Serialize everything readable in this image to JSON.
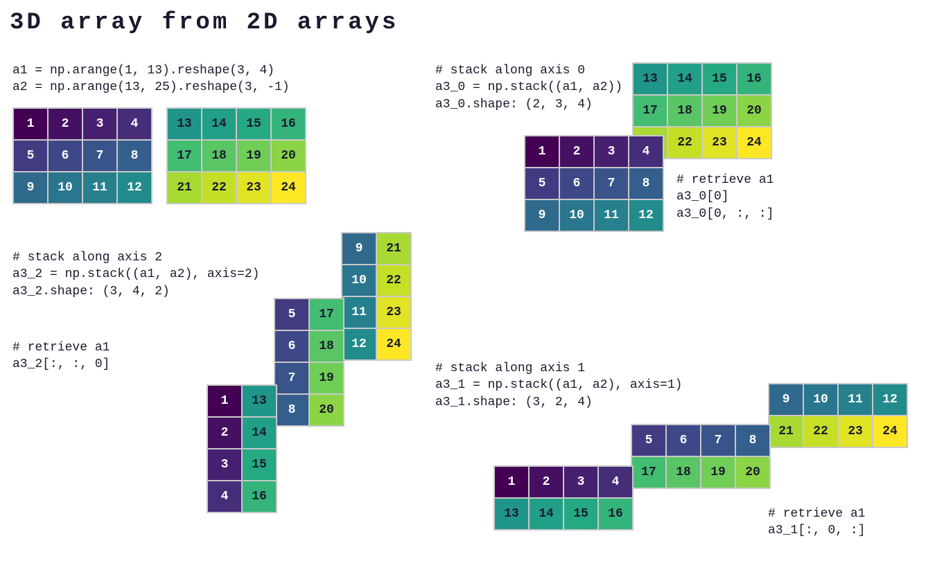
{
  "title": "3D array from 2D arrays",
  "colors": {
    "1": "#440154",
    "2": "#481a6c",
    "3": "#472f7d",
    "4": "#414487",
    "5": "#39568c",
    "6": "#31688e",
    "7": "#2a788e",
    "8": "#23888e",
    "9": "#1f988b",
    "10": "#22a884",
    "11": "#35b779",
    "12": "#54c568",
    "13": "#22a884",
    "14": "#35b779",
    "15": "#54c568",
    "16": "#7ad151",
    "17": "#7ad151",
    "18": "#a5db36",
    "19": "#a5db36",
    "20": "#d2e21b",
    "21": "#a5db36",
    "22": "#d2e21b",
    "23": "#d2e21b",
    "24": "#fde725"
  },
  "viridis24": {
    "1": "#440154",
    "2": "#481467",
    "3": "#482576",
    "4": "#463480",
    "5": "#414487",
    "6": "#3b528b",
    "7": "#355f8d",
    "8": "#2f6c8e",
    "9": "#2a788e",
    "10": "#25848e",
    "11": "#21918c",
    "12": "#1e9c89",
    "13": "#22a884",
    "14": "#2fb47c",
    "15": "#44bf70",
    "16": "#5ec962",
    "17": "#7ad151",
    "18": "#95d840",
    "19": "#b0dd2f",
    "20": "#cae11f",
    "21": "#e2e418",
    "22": "#f1e51d",
    "23": "#fde725",
    "24": "#fde725"
  },
  "setup_code": "a1 = np.arange(1, 13).reshape(3, 4)\na2 = np.arange(13, 25).reshape(3, -1)",
  "axis0_code": "# stack along axis 0\na3_0 = np.stack((a1, a2))\na3_0.shape: (2, 3, 4)",
  "axis0_retrieve": "# retrieve a1\na3_0[0]\na3_0[0, :, :]",
  "axis2_code": "# stack along axis 2\na3_2 = np.stack((a1, a2), axis=2)\na3_2.shape: (3, 4, 2)",
  "axis2_retrieve": "# retrieve a1\na3_2[:, :, 0]",
  "axis1_code": "# stack along axis 1\na3_1 = np.stack((a1, a2), axis=1)\na3_1.shape: (3, 2, 4)",
  "axis1_retrieve": "# retrieve a1\na3_1[:, 0, :]",
  "a1": [
    [
      1,
      2,
      3,
      4
    ],
    [
      5,
      6,
      7,
      8
    ],
    [
      9,
      10,
      11,
      12
    ]
  ],
  "a2": [
    [
      13,
      14,
      15,
      16
    ],
    [
      17,
      18,
      19,
      20
    ],
    [
      21,
      22,
      23,
      24
    ]
  ],
  "axis2_l0": [
    [
      1,
      13
    ],
    [
      2,
      14
    ],
    [
      3,
      15
    ],
    [
      4,
      16
    ]
  ],
  "axis2_l1": [
    [
      5,
      17
    ],
    [
      6,
      18
    ],
    [
      7,
      19
    ],
    [
      8,
      20
    ]
  ],
  "axis2_l2": [
    [
      9,
      21
    ],
    [
      10,
      22
    ],
    [
      11,
      23
    ],
    [
      12,
      24
    ]
  ],
  "axis1_l0": [
    [
      1,
      2,
      3,
      4
    ],
    [
      13,
      14,
      15,
      16
    ]
  ],
  "axis1_l1": [
    [
      5,
      6,
      7,
      8
    ],
    [
      17,
      18,
      19,
      20
    ]
  ],
  "axis1_l2": [
    [
      9,
      10,
      11,
      12
    ],
    [
      21,
      22,
      23,
      24
    ]
  ]
}
